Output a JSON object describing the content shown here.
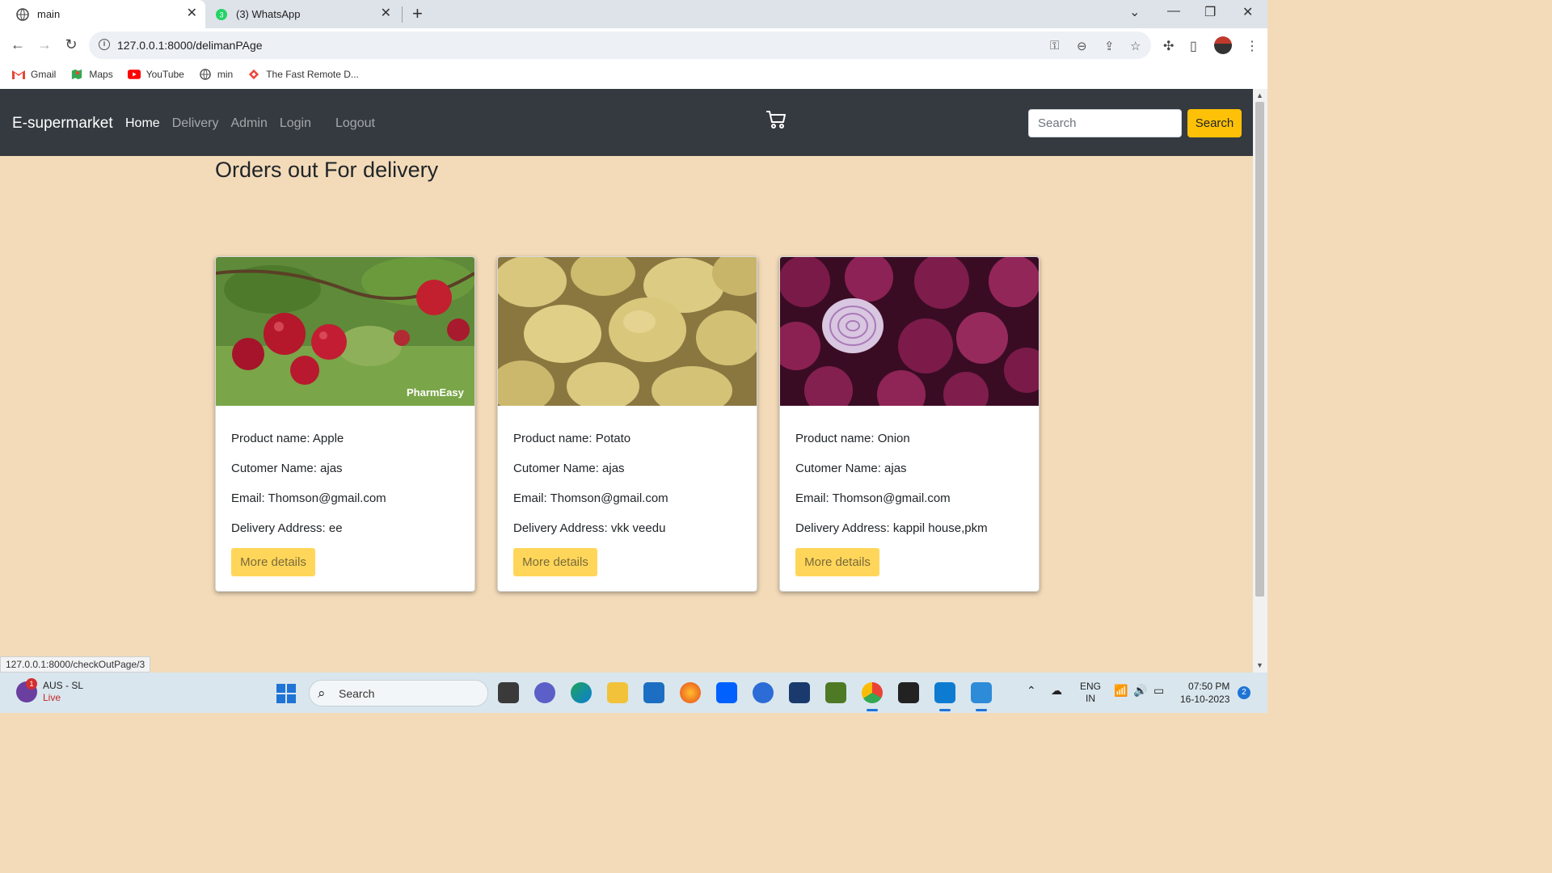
{
  "browser": {
    "tabs": [
      {
        "title": "main",
        "active": true
      },
      {
        "title": "(3) WhatsApp",
        "active": false,
        "badge": "3"
      }
    ],
    "url": "127.0.0.1:8000/delimanPAge",
    "bookmarks": [
      {
        "label": "Gmail",
        "icon": "gmail-icon"
      },
      {
        "label": "Maps",
        "icon": "maps-icon"
      },
      {
        "label": "YouTube",
        "icon": "youtube-icon"
      },
      {
        "label": "min",
        "icon": "globe-icon"
      },
      {
        "label": "The Fast Remote D...",
        "icon": "anydesk-icon"
      }
    ],
    "status_url": "127.0.0.1:8000/checkOutPage/3"
  },
  "navbar": {
    "brand": "E-supermarket",
    "links": {
      "home": "Home",
      "delivery": "Delivery",
      "admin": "Admin",
      "login": "Login",
      "logout": "Logout"
    },
    "search_placeholder": "Search",
    "search_button": "Search"
  },
  "page": {
    "title": "Orders out For delivery"
  },
  "orders": [
    {
      "product": "Product name: Apple",
      "customer": "Cutomer Name: ajas",
      "email": "Email: Thomson@gmail.com",
      "address": "Delivery Address: ee",
      "button": "More details",
      "image_watermark": "PharmEasy"
    },
    {
      "product": "Product name: Potato",
      "customer": "Cutomer Name: ajas",
      "email": "Email: Thomson@gmail.com",
      "address": "Delivery Address: vkk veedu",
      "button": "More details"
    },
    {
      "product": "Product name: Onion",
      "customer": "Cutomer Name: ajas",
      "email": "Email: Thomson@gmail.com",
      "address": "Delivery Address: kappil house,pkm",
      "button": "More details"
    }
  ],
  "taskbar": {
    "weather_badge": "1",
    "weather_title": "AUS - SL",
    "weather_status": "Live",
    "search": "Search",
    "lang1": "ENG",
    "lang2": "IN",
    "time": "07:50 PM",
    "date": "16-10-2023",
    "notifications": "2"
  },
  "colors": {
    "page_bg": "#f3dbb9",
    "navbar_bg": "#343a40",
    "accent": "#ffc107",
    "button_light": "#ffd65a"
  }
}
